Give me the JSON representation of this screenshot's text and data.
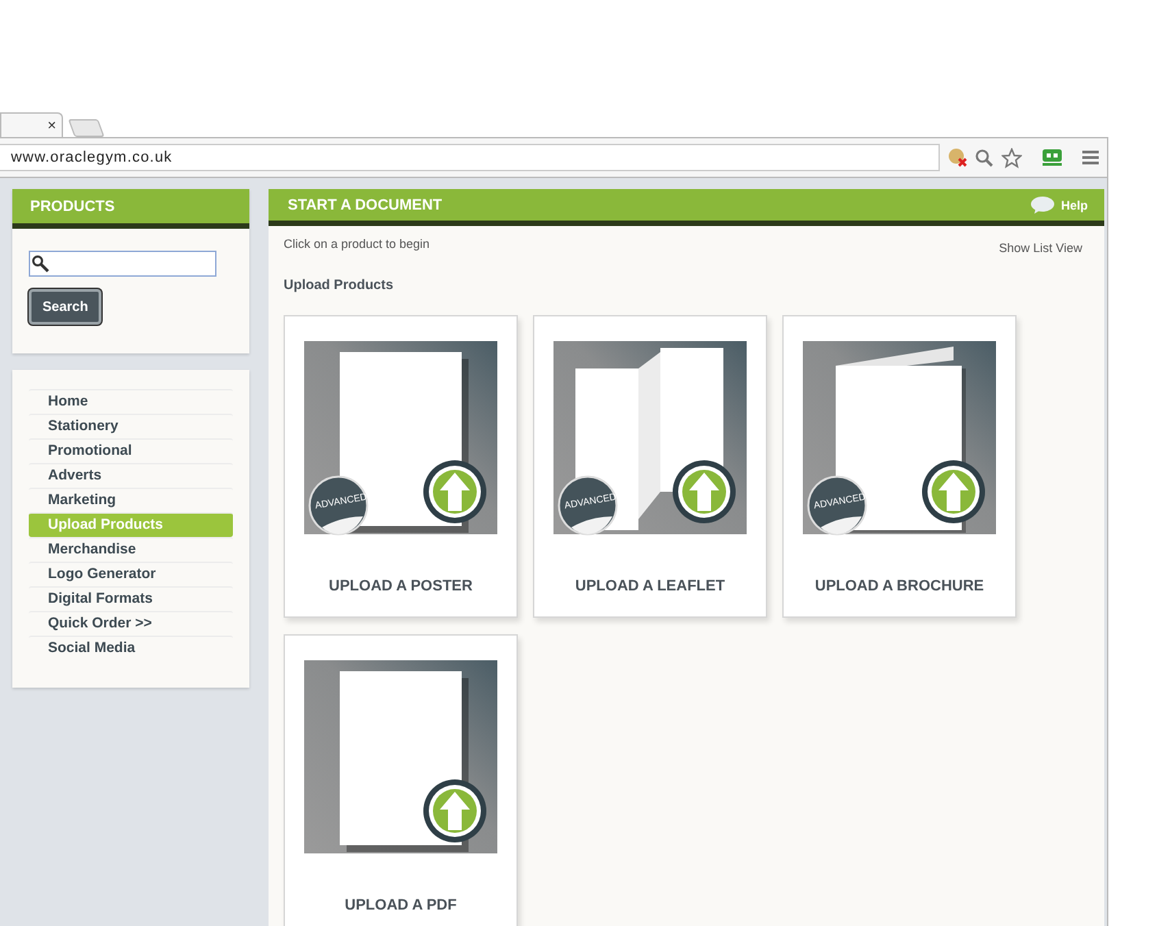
{
  "browser": {
    "tab_close": "×",
    "url": "www.oraclegym.co.uk"
  },
  "sidebar": {
    "title": "PRODUCTS",
    "search_button": "Search",
    "nav": [
      {
        "label": "Home",
        "selected": false
      },
      {
        "label": "Stationery",
        "selected": false
      },
      {
        "label": "Promotional",
        "selected": false
      },
      {
        "label": "Adverts",
        "selected": false
      },
      {
        "label": "Marketing",
        "selected": false
      },
      {
        "label": "Upload Products",
        "selected": true
      },
      {
        "label": "Merchandise",
        "selected": false
      },
      {
        "label": "Logo Generator",
        "selected": false
      },
      {
        "label": "Digital Formats",
        "selected": false
      },
      {
        "label": "Quick Order >>",
        "selected": false
      },
      {
        "label": "Social Media",
        "selected": false
      }
    ]
  },
  "main": {
    "title": "START A DOCUMENT",
    "help": "Help",
    "hint": "Click on a product to begin",
    "list_view": "Show List View",
    "section": "Upload Products",
    "products": [
      {
        "kind": "poster",
        "badge": "ADVANCED",
        "label": "UPLOAD A POSTER"
      },
      {
        "kind": "leaflet",
        "badge": "ADVANCED",
        "label": "UPLOAD A LEAFLET"
      },
      {
        "kind": "brochure",
        "badge": "ADVANCED",
        "label": "UPLOAD A BROCHURE"
      },
      {
        "kind": "pdf",
        "label": "UPLOAD A PDF"
      }
    ]
  }
}
